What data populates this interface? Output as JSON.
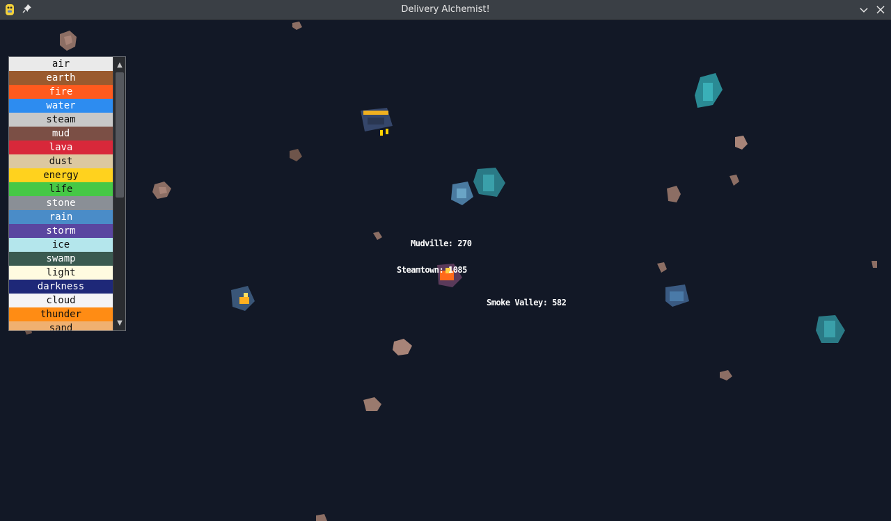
{
  "window": {
    "title": "Delivery Alchemist!"
  },
  "colors": {
    "background": "#121826",
    "titlebar": "#3a3f45"
  },
  "element_list": {
    "items": [
      {
        "label": "air",
        "bg": "#eaeaea",
        "fg": "#111111"
      },
      {
        "label": "earth",
        "bg": "#9a5a2e",
        "fg": "#ffffff"
      },
      {
        "label": "fire",
        "bg": "#ff5a1e",
        "fg": "#ffffff"
      },
      {
        "label": "water",
        "bg": "#2d8cf0",
        "fg": "#ffffff"
      },
      {
        "label": "steam",
        "bg": "#c8c8c8",
        "fg": "#111111"
      },
      {
        "label": "mud",
        "bg": "#7b4f45",
        "fg": "#ffffff"
      },
      {
        "label": "lava",
        "bg": "#d8283a",
        "fg": "#ffffff"
      },
      {
        "label": "dust",
        "bg": "#dcc8a0",
        "fg": "#111111"
      },
      {
        "label": "energy",
        "bg": "#ffd21e",
        "fg": "#111111"
      },
      {
        "label": "life",
        "bg": "#46c846",
        "fg": "#111111"
      },
      {
        "label": "stone",
        "bg": "#8a8f96",
        "fg": "#ffffff"
      },
      {
        "label": "rain",
        "bg": "#4a8cc8",
        "fg": "#ffffff"
      },
      {
        "label": "storm",
        "bg": "#5a46a0",
        "fg": "#ffffff"
      },
      {
        "label": "ice",
        "bg": "#b4e6ec",
        "fg": "#111111"
      },
      {
        "label": "swamp",
        "bg": "#3a5a50",
        "fg": "#ffffff"
      },
      {
        "label": "light",
        "bg": "#fffbe0",
        "fg": "#111111"
      },
      {
        "label": "darkness",
        "bg": "#1e2878",
        "fg": "#ffffff"
      },
      {
        "label": "cloud",
        "bg": "#f4f4f6",
        "fg": "#111111"
      },
      {
        "label": "thunder",
        "bg": "#ff8c14",
        "fg": "#111111"
      },
      {
        "label": "sand",
        "bg": "#f0b070",
        "fg": "#111111"
      }
    ],
    "scroll_up": "▲",
    "scroll_down": "▼"
  },
  "cities": [
    {
      "label": "Mudville: 270"
    },
    {
      "label": "Steamtown: 1085"
    },
    {
      "label": "Smoke Valley: 582"
    }
  ],
  "icons": {
    "app": "python-icon",
    "pin": "pin-icon",
    "minimize": "chevron-down-icon",
    "close": "close-icon"
  },
  "glyphs": {
    "pin": "📌",
    "minimize": "﹀",
    "close": "✕"
  }
}
